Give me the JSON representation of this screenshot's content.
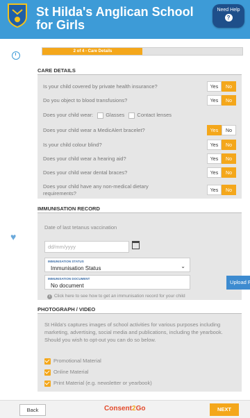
{
  "header": {
    "school_name": "St Hilda's Anglican School for Girls",
    "help_label": "Need Help",
    "help_glyph": "?"
  },
  "progress": {
    "label": "2 of 4 - Care Details",
    "fraction": 0.5
  },
  "care": {
    "title": "CARE DETAILS",
    "yes": "Yes",
    "no": "No",
    "questions": [
      {
        "text": "Is your child covered by private health insurance?",
        "answer": "No"
      },
      {
        "text": "Do you object to blood transfusions?",
        "answer": "No"
      },
      {
        "text": "Does your child wear a MedicAlert bracelet?",
        "answer": "Yes"
      },
      {
        "text": "Is your child colour blind?",
        "answer": "No"
      },
      {
        "text": "Does your child wear a hearing aid?",
        "answer": "No"
      },
      {
        "text": "Does your child wear dental braces?",
        "answer": "No"
      },
      {
        "text": "Does your child have any non-medical dietary requirements?",
        "answer": "No"
      }
    ],
    "wear_question": "Does your child wear:",
    "wear_options": [
      "Glasses",
      "Contact lenses"
    ]
  },
  "immunisation": {
    "title": "IMMUNISATION RECORD",
    "tetanus_label": "Date of last tetanus vaccination",
    "date_placeholder": "dd/mm/yyyy",
    "status_label": "IMMUNISATION STATUS",
    "status_value": "Immunisation Status",
    "document_label": "IMMUNISATION DOCUMENT",
    "document_value": "No document",
    "upload_label": "Upload File",
    "info_text": "Click here to see how to get an immunisation record for your child"
  },
  "photo": {
    "title": "PHOTOGRAPH / VIDEO",
    "paragraph": "St Hilda's captures images of school activities for various purposes including marketing, advertising, social media and publications, including the yearbook. Should you wish to opt-out you can do so below.",
    "options": [
      "Promotional Material",
      "Online Material",
      "Print Material (e.g. newsletter or yearbook)"
    ]
  },
  "footer": {
    "back": "Back",
    "brand_a": "Consent",
    "brand_b": "2",
    "brand_c": "Go",
    "next": "NEXT"
  },
  "colors": {
    "header": "#3d9bd7",
    "accent": "#f4a71b",
    "help": "#1e4f8a"
  }
}
